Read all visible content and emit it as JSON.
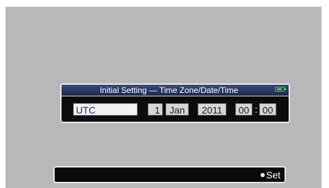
{
  "dialog": {
    "title": "Initial Setting — Time Zone/Date/Time",
    "battery_icon": "battery-icon"
  },
  "fields": {
    "time_zone": "UTC",
    "day": "1",
    "month": "Jan",
    "year": "2011",
    "hour": "00",
    "time_separator": ":",
    "minute": "00"
  },
  "bottom_bar": {
    "set_label": "Set",
    "set_icon": "dot-icon"
  },
  "colors": {
    "screen_background": "#b8b8b8",
    "header_blue": "#2a3a66",
    "battery_green": "#3cd23c"
  }
}
